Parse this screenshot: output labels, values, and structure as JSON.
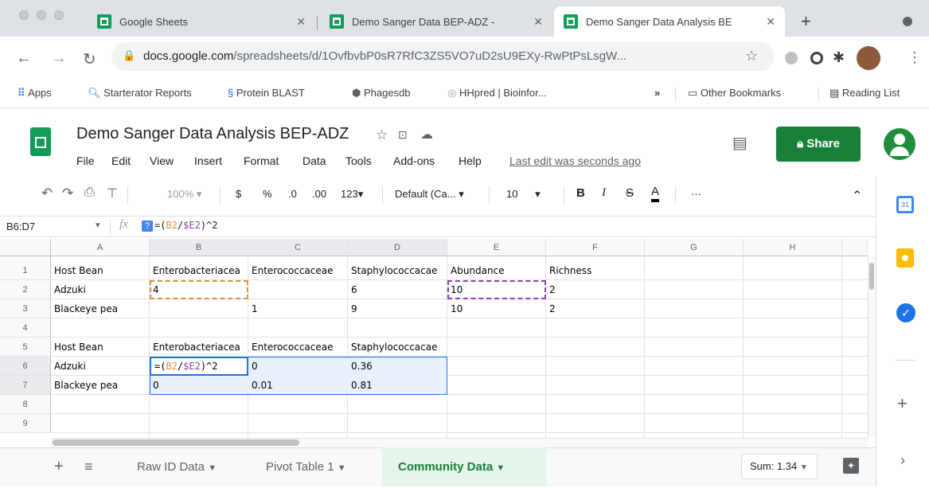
{
  "browser": {
    "tabs": [
      {
        "title": "Google Sheets",
        "active": false
      },
      {
        "title": "Demo Sanger Data BEP-ADZ -",
        "active": false
      },
      {
        "title": "Demo Sanger Data Analysis BE",
        "active": true
      }
    ],
    "new_tab": "+",
    "url_domain": "docs.google.com",
    "url_path": "/spreadsheets/d/1OvfbvbP0sR7RfC3ZS5VO7uD2sU9EXy-RwPtPsLsgW...",
    "bookmarks": [
      "Apps",
      "Starterator Reports",
      "Protein BLAST",
      "Phagesdb",
      "HHpred | Bioinfor..."
    ],
    "more": "»",
    "other_bookmarks": "Other Bookmarks",
    "reading_list": "Reading List"
  },
  "doc": {
    "title": "Demo Sanger Data Analysis BEP-ADZ",
    "menu": [
      "File",
      "Edit",
      "View",
      "Insert",
      "Format",
      "Data",
      "Tools",
      "Add-ons",
      "Help"
    ],
    "last_edit": "Last edit was seconds ago",
    "share": "Share"
  },
  "format_bar": {
    "zoom": "100%",
    "currency": "$",
    "percent": "%",
    "dec_less": ".0",
    "dec_more": ".00",
    "more_formats": "123",
    "font": "Default (Ca...",
    "size": "10",
    "bold": "B",
    "italic": "I",
    "strike": "S",
    "text_color": "A",
    "more": "···"
  },
  "formula_bar": {
    "name_box": "B6:D7",
    "fx": "fx",
    "help": "?",
    "formula_prefix": "=(",
    "formula_ref1": "B2",
    "formula_slash": "/",
    "formula_ref2": "$E2",
    "formula_suffix": ")^2"
  },
  "columns": [
    "A",
    "B",
    "C",
    "D",
    "E",
    "F",
    "G",
    "H"
  ],
  "rows": [
    "1",
    "2",
    "3",
    "4",
    "5",
    "6",
    "7",
    "8",
    "9"
  ],
  "cells": {
    "A1": "Host Bean",
    "B1": "Enterobacteriacea",
    "C1": "Enterococcaceae",
    "D1": "Staphylococcacae",
    "E1": "Abundance",
    "F1": "Richness",
    "A2": "Adzuki",
    "B2": "4",
    "D2": "6",
    "E2": "10",
    "F2": "2",
    "A3": "Blackeye pea",
    "C3": "1",
    "D3": "9",
    "E3": "10",
    "F3": "2",
    "A5": "Host Bean",
    "B5": "Enterobacteriacea",
    "C5": "Enterococcaceae",
    "D5": "Staphylococcacae",
    "A6": "Adzuki",
    "C6": "0",
    "D6": "0.36",
    "A7": "Blackeye pea",
    "B7": "0",
    "C7": "0.01",
    "D7": "0.81"
  },
  "edit_cell": {
    "prefix": "=(",
    "ref1": "B2",
    "slash": "/",
    "ref2": "$E2",
    "suffix": ")^2"
  },
  "sheets": {
    "add": "+",
    "list": "≡",
    "tabs": [
      {
        "label": "Raw ID Data",
        "active": false
      },
      {
        "label": "Pivot Table 1",
        "active": false
      },
      {
        "label": "Community Data",
        "active": true
      }
    ],
    "sum": "Sum: 1.34"
  },
  "colors": {
    "sheets_green": "#0f9d58",
    "ref_orange": "#e69138",
    "ref_purple": "#8e44ad",
    "selection_blue": "#1a73e8"
  }
}
